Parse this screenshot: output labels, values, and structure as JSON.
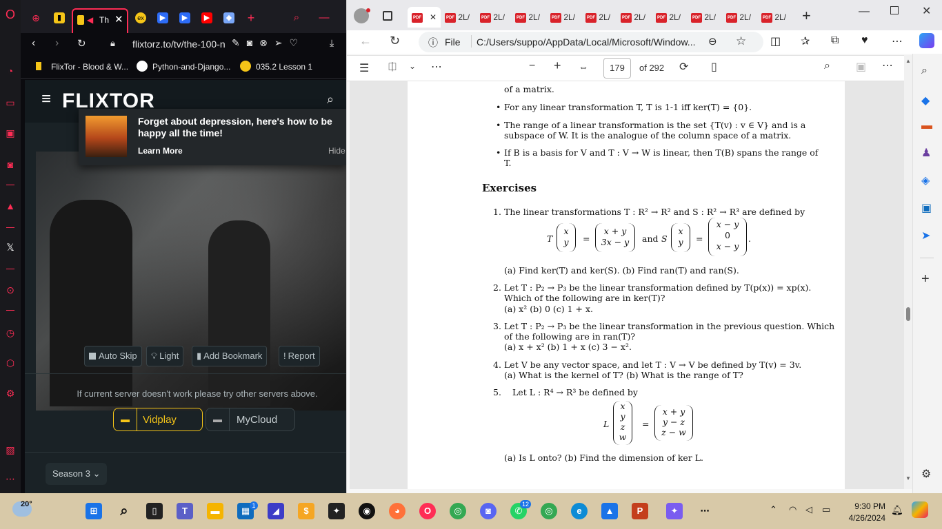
{
  "opera": {
    "tab_active_label": "Th",
    "address": "flixtorz.to/tv/the-100-n",
    "bookmarks": [
      "FlixTor - Blood & W...",
      "Python-and-Django...",
      "035.2 Lesson 1"
    ],
    "site_logo": "FLIXTOR",
    "notification": {
      "title": "Forget about depression, here's how to be happy all the time!",
      "learn_more": "Learn More",
      "hide": "Hide"
    },
    "player_buttons": [
      "Auto Skip",
      "Light",
      "Add Bookmark",
      "Report"
    ],
    "server_note": "If current server doesn't work please try other servers above.",
    "servers": [
      "Vidplay",
      "MyCloud"
    ],
    "season_label": "Season 3"
  },
  "edge": {
    "tab_label": "2L/",
    "address_prefix": "File",
    "address": "C:/Users/suppo/AppData/Local/Microsoft/Window...",
    "page_current": "179",
    "page_total": "of 292"
  },
  "pdf": {
    "line0": "of a matrix.",
    "bullets": [
      "For any linear transformation T, T is 1-1 iff ker(T) = {0}.",
      "The range of a linear transformation is the set {T(v) : v ∈ V} and is a",
      "subspace of W. It is the analogue of the column space of a matrix.",
      "If B is a basis for V and T : V → W is linear, then T(B) spans the range of",
      "T."
    ],
    "heading": "Exercises",
    "ex1": "The linear transformations T : R² → R² and S : R² → R³ are defined by",
    "ex1_and": "and",
    "ex1_parts": "(a) Find ker(T) and ker(S).        (b) Find ran(T) and ran(S).",
    "ex2_a": "Let T : P₂ → P₃ be the linear transformation defined by T(p(x)) = xp(x).",
    "ex2_b": "Which of the following are in ker(T)?",
    "ex2_c": "(a) x²        (b) 0        (c) 1 + x.",
    "ex3_a": "Let T : P₂ → P₃ be the linear transformation in the previous question. Which",
    "ex3_b": "of the following are in ran(T)?",
    "ex3_c": "(a) x + x²        (b) 1 + x        (c) 3 − x².",
    "ex4_a": "Let V be any vector space, and let T : V → V be defined by T(v) = 3v.",
    "ex4_b": "(a) What is the kernel of T?        (b) What is the range of T?",
    "ex5": "Let L : R⁴ → R³ be defined by",
    "ex5_parts": "(a) Is L onto?        (b) Find the dimension of ker L.",
    "numbers": [
      "1.",
      "2.",
      "3.",
      "4.",
      "5."
    ],
    "mat_T_in": [
      "x",
      "y"
    ],
    "mat_T_out": [
      "x + y",
      "3x − y"
    ],
    "mat_S_in": [
      "x",
      "y"
    ],
    "mat_S_out": [
      "x − y",
      "0",
      "x − y"
    ],
    "mat_L_in": [
      "x",
      "y",
      "z",
      "w"
    ],
    "mat_L_out": [
      "x + y",
      "y − z",
      "z − w"
    ]
  },
  "taskbar": {
    "weather_temp": "20°",
    "time": "9:30 PM",
    "date": "4/26/2024",
    "badges": [
      "1",
      "12"
    ]
  },
  "colors": {
    "opera_accent": "#ff2d55",
    "vidplay": "#f5c518",
    "edge_pdf_red": "#d9222a"
  }
}
